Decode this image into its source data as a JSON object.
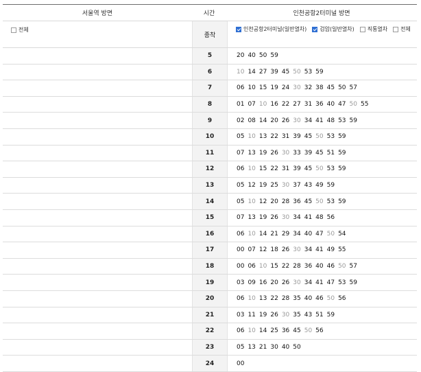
{
  "header": {
    "left_title": "서울역 방면",
    "mid_title": "시간",
    "right_title": "인천공항2터미널 방면"
  },
  "filters": {
    "left": [
      {
        "label": "전체",
        "checked": false
      }
    ],
    "mid_label": "종착",
    "right": [
      {
        "label": "인천공항2터미널(일반열차)",
        "checked": true
      },
      {
        "label": "검암(일반열차)",
        "checked": true
      },
      {
        "label": "직통열차",
        "checked": false
      },
      {
        "label": "전체",
        "checked": false
      }
    ]
  },
  "schedule": [
    {
      "hour": "5",
      "minutes": [
        {
          "m": "20",
          "g": false
        },
        {
          "m": "40",
          "g": false
        },
        {
          "m": "50",
          "g": false
        },
        {
          "m": "59",
          "g": false
        }
      ]
    },
    {
      "hour": "6",
      "minutes": [
        {
          "m": "10",
          "g": true
        },
        {
          "m": "14",
          "g": false
        },
        {
          "m": "27",
          "g": false
        },
        {
          "m": "39",
          "g": false
        },
        {
          "m": "45",
          "g": false
        },
        {
          "m": "50",
          "g": true
        },
        {
          "m": "53",
          "g": false
        },
        {
          "m": "59",
          "g": false
        }
      ]
    },
    {
      "hour": "7",
      "minutes": [
        {
          "m": "06",
          "g": false
        },
        {
          "m": "10",
          "g": false
        },
        {
          "m": "15",
          "g": false
        },
        {
          "m": "19",
          "g": false
        },
        {
          "m": "24",
          "g": false
        },
        {
          "m": "30",
          "g": true
        },
        {
          "m": "32",
          "g": false
        },
        {
          "m": "38",
          "g": false
        },
        {
          "m": "45",
          "g": false
        },
        {
          "m": "50",
          "g": false
        },
        {
          "m": "57",
          "g": false
        }
      ]
    },
    {
      "hour": "8",
      "minutes": [
        {
          "m": "01",
          "g": false
        },
        {
          "m": "07",
          "g": false
        },
        {
          "m": "10",
          "g": true
        },
        {
          "m": "16",
          "g": false
        },
        {
          "m": "22",
          "g": false
        },
        {
          "m": "27",
          "g": false
        },
        {
          "m": "31",
          "g": false
        },
        {
          "m": "36",
          "g": false
        },
        {
          "m": "40",
          "g": false
        },
        {
          "m": "47",
          "g": false
        },
        {
          "m": "50",
          "g": true
        },
        {
          "m": "55",
          "g": false
        }
      ]
    },
    {
      "hour": "9",
      "minutes": [
        {
          "m": "02",
          "g": false
        },
        {
          "m": "08",
          "g": false
        },
        {
          "m": "14",
          "g": false
        },
        {
          "m": "20",
          "g": false
        },
        {
          "m": "26",
          "g": false
        },
        {
          "m": "30",
          "g": true
        },
        {
          "m": "34",
          "g": false
        },
        {
          "m": "41",
          "g": false
        },
        {
          "m": "48",
          "g": false
        },
        {
          "m": "53",
          "g": false
        },
        {
          "m": "59",
          "g": false
        }
      ]
    },
    {
      "hour": "10",
      "minutes": [
        {
          "m": "05",
          "g": false
        },
        {
          "m": "10",
          "g": true
        },
        {
          "m": "13",
          "g": false
        },
        {
          "m": "22",
          "g": false
        },
        {
          "m": "31",
          "g": false
        },
        {
          "m": "39",
          "g": false
        },
        {
          "m": "45",
          "g": false
        },
        {
          "m": "50",
          "g": true
        },
        {
          "m": "53",
          "g": false
        },
        {
          "m": "59",
          "g": false
        }
      ]
    },
    {
      "hour": "11",
      "minutes": [
        {
          "m": "07",
          "g": false
        },
        {
          "m": "13",
          "g": false
        },
        {
          "m": "19",
          "g": false
        },
        {
          "m": "26",
          "g": false
        },
        {
          "m": "30",
          "g": true
        },
        {
          "m": "33",
          "g": false
        },
        {
          "m": "39",
          "g": false
        },
        {
          "m": "45",
          "g": false
        },
        {
          "m": "51",
          "g": false
        },
        {
          "m": "59",
          "g": false
        }
      ]
    },
    {
      "hour": "12",
      "minutes": [
        {
          "m": "06",
          "g": false
        },
        {
          "m": "10",
          "g": true
        },
        {
          "m": "15",
          "g": false
        },
        {
          "m": "22",
          "g": false
        },
        {
          "m": "31",
          "g": false
        },
        {
          "m": "39",
          "g": false
        },
        {
          "m": "45",
          "g": false
        },
        {
          "m": "50",
          "g": true
        },
        {
          "m": "53",
          "g": false
        },
        {
          "m": "59",
          "g": false
        }
      ]
    },
    {
      "hour": "13",
      "minutes": [
        {
          "m": "05",
          "g": false
        },
        {
          "m": "12",
          "g": false
        },
        {
          "m": "19",
          "g": false
        },
        {
          "m": "25",
          "g": false
        },
        {
          "m": "30",
          "g": true
        },
        {
          "m": "37",
          "g": false
        },
        {
          "m": "43",
          "g": false
        },
        {
          "m": "49",
          "g": false
        },
        {
          "m": "59",
          "g": false
        }
      ]
    },
    {
      "hour": "14",
      "minutes": [
        {
          "m": "05",
          "g": false
        },
        {
          "m": "10",
          "g": true
        },
        {
          "m": "12",
          "g": false
        },
        {
          "m": "20",
          "g": false
        },
        {
          "m": "28",
          "g": false
        },
        {
          "m": "36",
          "g": false
        },
        {
          "m": "45",
          "g": false
        },
        {
          "m": "50",
          "g": true
        },
        {
          "m": "53",
          "g": false
        },
        {
          "m": "59",
          "g": false
        }
      ]
    },
    {
      "hour": "15",
      "minutes": [
        {
          "m": "07",
          "g": false
        },
        {
          "m": "13",
          "g": false
        },
        {
          "m": "19",
          "g": false
        },
        {
          "m": "26",
          "g": false
        },
        {
          "m": "30",
          "g": true
        },
        {
          "m": "34",
          "g": false
        },
        {
          "m": "41",
          "g": false
        },
        {
          "m": "48",
          "g": false
        },
        {
          "m": "56",
          "g": false
        }
      ]
    },
    {
      "hour": "16",
      "minutes": [
        {
          "m": "06",
          "g": false
        },
        {
          "m": "10",
          "g": true
        },
        {
          "m": "14",
          "g": false
        },
        {
          "m": "21",
          "g": false
        },
        {
          "m": "29",
          "g": false
        },
        {
          "m": "34",
          "g": false
        },
        {
          "m": "40",
          "g": false
        },
        {
          "m": "47",
          "g": false
        },
        {
          "m": "50",
          "g": true
        },
        {
          "m": "54",
          "g": false
        }
      ]
    },
    {
      "hour": "17",
      "minutes": [
        {
          "m": "00",
          "g": false
        },
        {
          "m": "07",
          "g": false
        },
        {
          "m": "12",
          "g": false
        },
        {
          "m": "18",
          "g": false
        },
        {
          "m": "26",
          "g": false
        },
        {
          "m": "30",
          "g": true
        },
        {
          "m": "34",
          "g": false
        },
        {
          "m": "41",
          "g": false
        },
        {
          "m": "49",
          "g": false
        },
        {
          "m": "55",
          "g": false
        }
      ]
    },
    {
      "hour": "18",
      "minutes": [
        {
          "m": "00",
          "g": false
        },
        {
          "m": "06",
          "g": false
        },
        {
          "m": "10",
          "g": true
        },
        {
          "m": "15",
          "g": false
        },
        {
          "m": "22",
          "g": false
        },
        {
          "m": "28",
          "g": false
        },
        {
          "m": "36",
          "g": false
        },
        {
          "m": "40",
          "g": false
        },
        {
          "m": "46",
          "g": false
        },
        {
          "m": "50",
          "g": true
        },
        {
          "m": "57",
          "g": false
        }
      ]
    },
    {
      "hour": "19",
      "minutes": [
        {
          "m": "03",
          "g": false
        },
        {
          "m": "09",
          "g": false
        },
        {
          "m": "16",
          "g": false
        },
        {
          "m": "20",
          "g": false
        },
        {
          "m": "26",
          "g": false
        },
        {
          "m": "30",
          "g": true
        },
        {
          "m": "34",
          "g": false
        },
        {
          "m": "41",
          "g": false
        },
        {
          "m": "47",
          "g": false
        },
        {
          "m": "53",
          "g": false
        },
        {
          "m": "59",
          "g": false
        }
      ]
    },
    {
      "hour": "20",
      "minutes": [
        {
          "m": "06",
          "g": false
        },
        {
          "m": "10",
          "g": true
        },
        {
          "m": "13",
          "g": false
        },
        {
          "m": "22",
          "g": false
        },
        {
          "m": "28",
          "g": false
        },
        {
          "m": "35",
          "g": false
        },
        {
          "m": "40",
          "g": false
        },
        {
          "m": "46",
          "g": false
        },
        {
          "m": "50",
          "g": true
        },
        {
          "m": "56",
          "g": false
        }
      ]
    },
    {
      "hour": "21",
      "minutes": [
        {
          "m": "03",
          "g": false
        },
        {
          "m": "11",
          "g": false
        },
        {
          "m": "19",
          "g": false
        },
        {
          "m": "26",
          "g": false
        },
        {
          "m": "30",
          "g": true
        },
        {
          "m": "35",
          "g": false
        },
        {
          "m": "43",
          "g": false
        },
        {
          "m": "51",
          "g": false
        },
        {
          "m": "59",
          "g": false
        }
      ]
    },
    {
      "hour": "22",
      "minutes": [
        {
          "m": "06",
          "g": false
        },
        {
          "m": "10",
          "g": true
        },
        {
          "m": "14",
          "g": false
        },
        {
          "m": "25",
          "g": false
        },
        {
          "m": "36",
          "g": false
        },
        {
          "m": "45",
          "g": false
        },
        {
          "m": "50",
          "g": true
        },
        {
          "m": "56",
          "g": false
        }
      ]
    },
    {
      "hour": "23",
      "minutes": [
        {
          "m": "05",
          "g": false
        },
        {
          "m": "13",
          "g": false
        },
        {
          "m": "21",
          "g": false
        },
        {
          "m": "30",
          "g": false
        },
        {
          "m": "40",
          "g": false
        },
        {
          "m": "50",
          "g": false
        }
      ]
    },
    {
      "hour": "24",
      "minutes": [
        {
          "m": "00",
          "g": false
        }
      ]
    }
  ]
}
